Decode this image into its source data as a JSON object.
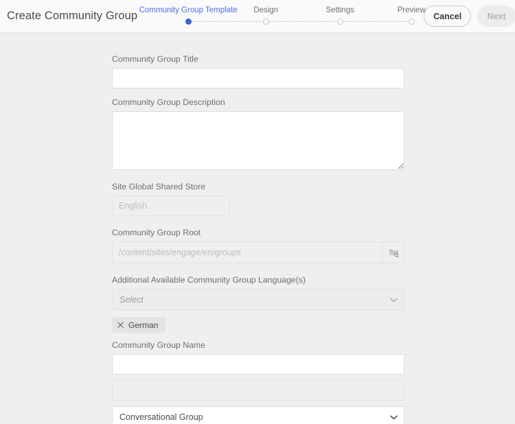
{
  "header": {
    "title": "Create Community Group",
    "steps": [
      {
        "label": "Community Group Template",
        "state": "active"
      },
      {
        "label": "Design",
        "state": "inactive"
      },
      {
        "label": "Settings",
        "state": "inactive"
      },
      {
        "label": "Preview",
        "state": "inactive"
      }
    ],
    "cancel_label": "Cancel",
    "next_label": "Next",
    "active_color": "#3b63d6"
  },
  "form": {
    "title": {
      "label": "Community Group Title",
      "value": "",
      "placeholder": ""
    },
    "description": {
      "label": "Community Group Description",
      "value": "",
      "placeholder": ""
    },
    "shared_store": {
      "label": "Site Global Shared Store",
      "value": "",
      "placeholder": "English"
    },
    "group_root": {
      "label": "Community Group Root",
      "value": "",
      "placeholder": "/content/sites/engage/en/groups",
      "picker_icon": "folder-search-icon"
    },
    "additional_languages": {
      "label": "Additional Available Community Group Language(s)",
      "selected": "Select",
      "chips": [
        {
          "label": "German",
          "remove_icon": "close-icon"
        }
      ]
    },
    "group_name": {
      "label": "Community Group Name",
      "value": "",
      "placeholder": ""
    },
    "secondary_field": {
      "label": "",
      "value": "",
      "placeholder": ""
    },
    "group_type": {
      "label": "",
      "selected": "Conversational Group"
    }
  }
}
